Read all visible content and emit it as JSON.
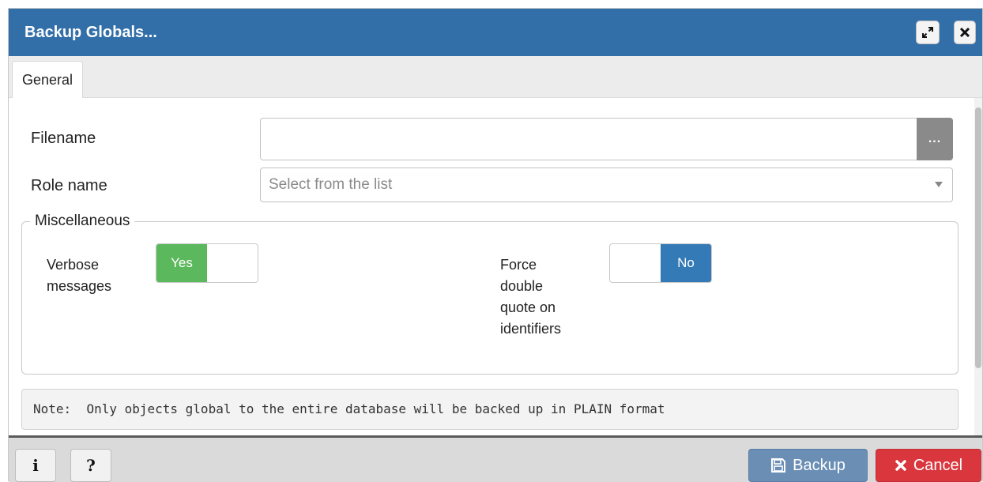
{
  "dialog": {
    "title": "Backup Globals...",
    "maximize_icon": "expand-icon",
    "close_icon": "close-icon"
  },
  "tabs": [
    {
      "label": "General",
      "active": true
    }
  ],
  "form": {
    "filename": {
      "label": "Filename",
      "value": "",
      "browse_label": "..."
    },
    "role_name": {
      "label": "Role name",
      "placeholder": "Select from the list",
      "value": ""
    }
  },
  "miscellaneous": {
    "legend": "Miscellaneous",
    "verbose": {
      "label_line1": "Verbose",
      "label_line2": "messages",
      "value": "Yes",
      "on": true
    },
    "force_quote": {
      "label_line1": "Force",
      "label_line2": "double",
      "label_line3": "quote on",
      "label_line4": "identifiers",
      "value": "No",
      "on": false
    }
  },
  "note": {
    "prefix": "Note:",
    "text": "Only objects global to the entire database will be backed up in PLAIN format"
  },
  "footer": {
    "info_label": "i",
    "help_label": "?",
    "backup_label": "Backup",
    "cancel_label": "Cancel"
  },
  "colors": {
    "titlebar": "#326ea8",
    "switch_yes": "#5cb85c",
    "switch_no": "#337ab7",
    "backup_button": "#6b8eb5",
    "cancel_button": "#d9363e"
  }
}
